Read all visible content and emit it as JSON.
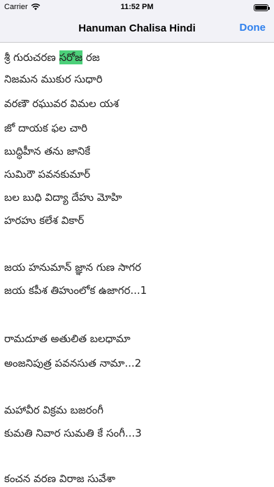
{
  "status_bar": {
    "carrier": "Carrier",
    "time": "11:52 PM"
  },
  "nav": {
    "title": "Hanuman Chalisa Hindi",
    "done_label": "Done"
  },
  "highlight_color": "#4cd07a",
  "lyrics": {
    "l1_before": "శ్రీ గురుచరణ ",
    "l1_highlight": "సరోజ",
    "l1_after": " రజ",
    "l2": "నిజమన ముకుర సుధారి",
    "l3": "వరణౌ రఘువర విమల యశ",
    "l4": "జో దాయక ఫల చారి",
    "l5": "బుద్ధిహీన తను జానికే",
    "l6": "సుమిరౌ పవనకుమార్",
    "l7": "బల బుధి విద్యా దేహు మోహి",
    "l8": "హరహు కలేశ వికార్",
    "l9": "జయ హనుమాన్ జ్ఞాన గుణ సాగర",
    "l10": "జయ కపీశ తిహుంలోక ఉజాగర...1",
    "l11": "రామదూత అతులిత బలధామా",
    "l12": "అంజనిపుత్ర పవనసుత నామా...2",
    "l13": "మహావీర విక్రమ బజరంగీ",
    "l14": "కుమతి నివార సుమతి కే సంగీ...3",
    "l15": "కంచన వరణ విరాజ సువేశా"
  }
}
